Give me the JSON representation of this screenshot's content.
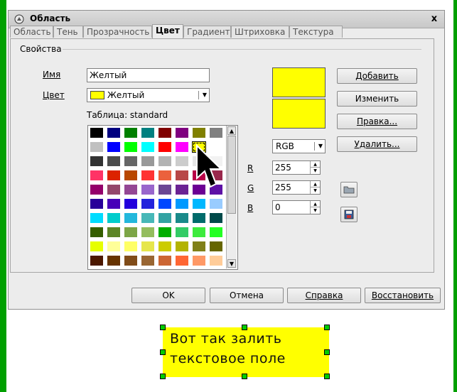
{
  "window": {
    "title": "Область",
    "close_label": "x"
  },
  "tabs": [
    "Область",
    "Тень",
    "Прозрачность",
    "Цвет",
    "Градиент",
    "Штриховка",
    "Текстура"
  ],
  "active_tab": "Цвет",
  "properties": {
    "legend": "Свойства",
    "name_label": "Имя",
    "name_value": "Желтый",
    "color_label": "Цвет",
    "color_value": "Желтый",
    "table_label": "Таблица: standard"
  },
  "palette": [
    [
      "#000000",
      "#000080",
      "#008000",
      "#008080",
      "#800000",
      "#800080",
      "#808000",
      "#808080"
    ],
    [
      "#c0c0c0",
      "#0000ff",
      "#00ff00",
      "#00ffff",
      "#ff0000",
      "#ff00ff",
      "#ffff00",
      "#ffffff"
    ],
    [
      "#333333",
      "#4c4c4c",
      "#666666",
      "#999999",
      "#b3b3b3",
      "#cccccc",
      "#e6e6e6",
      "#f2f2f2"
    ],
    [
      "#ff3366",
      "#dc2300",
      "#b84700",
      "#ff3333",
      "#eb613d",
      "#b84747",
      "#b80047",
      "#99284c"
    ],
    [
      "#94006b",
      "#94476b",
      "#944794",
      "#9966cc",
      "#6b4794",
      "#6b2394",
      "#6b0094",
      "#5e11a6"
    ],
    [
      "#280099",
      "#4700b8",
      "#2300dc",
      "#2323dc",
      "#0047ff",
      "#0099ff",
      "#00b8ff",
      "#99ccff"
    ],
    [
      "#00dcff",
      "#00cccc",
      "#23b8dc",
      "#47b8b8",
      "#33a3a3",
      "#198a8a",
      "#006b6b",
      "#004a4a"
    ],
    [
      "#355e00",
      "#5c8526",
      "#7da647",
      "#94bd5e",
      "#00ae00",
      "#33cc66",
      "#3deb3d",
      "#23ff23"
    ],
    [
      "#e6ff00",
      "#ffff99",
      "#ffff66",
      "#e6e64c",
      "#cccc00",
      "#b3b300",
      "#808019",
      "#666600"
    ],
    [
      "#4c1900",
      "#663300",
      "#804c19",
      "#996633",
      "#cc6633",
      "#ff6633",
      "#ff9966",
      "#ffcc99"
    ]
  ],
  "selected_cell": [
    1,
    6
  ],
  "color_model": "RGB",
  "rgb": {
    "r_label": "R",
    "r_value": "255",
    "g_label": "G",
    "g_value": "255",
    "b_label": "B",
    "b_value": "0"
  },
  "preview_color": "#ffff00",
  "buttons": {
    "add": "Добавить",
    "change": "Изменить",
    "edit": "Правка...",
    "delete": "Удалить..."
  },
  "footer": {
    "ok": "OK",
    "cancel": "Отмена",
    "help": "Справка",
    "restore": "Восстановить"
  },
  "textbox": {
    "line1": "Вот так залить",
    "line2": "текстовое поле",
    "fill": "#ffff00"
  },
  "colors": {
    "accent_green": "#00a000"
  }
}
